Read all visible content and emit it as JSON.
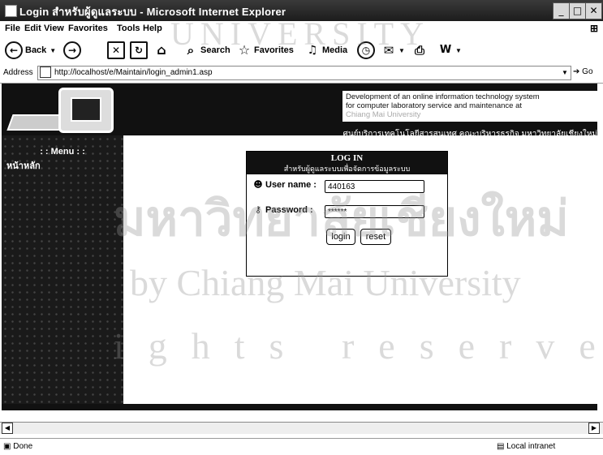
{
  "window": {
    "title": "Login สำหรับผู้ดูแลระบบ - Microsoft Internet Explorer"
  },
  "menu": [
    "File",
    "Edit",
    "View",
    "Favorites",
    "Tools",
    "Help"
  ],
  "toolbar": {
    "back": "Back",
    "search": "Search",
    "favorites": "Favorites",
    "media": "Media"
  },
  "address": {
    "label": "Address",
    "url": "http://localhost/e/Maintain/login_admin1.asp",
    "go": "Go"
  },
  "page": {
    "description_line1": "Development of an online information technology system",
    "description_line2": "for computer laboratory service and maintenance at",
    "description_line3": "Chiang Mai University",
    "subtitle": "ศูนย์บริการเทคโนโลยีสารสนเทศ คณะบริหารธุรกิจ มหาวิทยาลัยเชียงใหม่",
    "sidebar_heading": ": : Menu : :",
    "sidebar_item": "หน้าหลัก"
  },
  "login": {
    "title": "LOG IN",
    "subtitle": "สำหรับผู้ดูแลระบบเพื่อจัดการข้อมูลระบบ",
    "username_label": "User name :",
    "username_value": "440163",
    "password_label": "Password :",
    "password_value": "******",
    "login_button": "login",
    "reset_button": "reset"
  },
  "status": {
    "text": "Done",
    "zone": "Local intranet"
  },
  "watermark": {
    "line1": "มหาวิทยาลัยเชียงใหม่",
    "line2": "by Chiang Mai University",
    "line3": "ights reserved",
    "arc": "UNIVERSITY"
  }
}
